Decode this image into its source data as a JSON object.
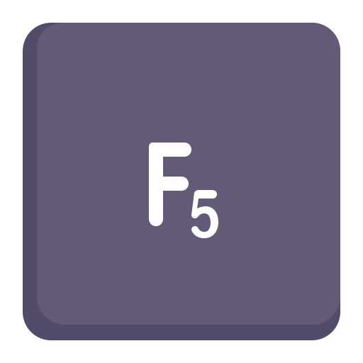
{
  "key": {
    "main_letter": "F",
    "subscript": "5",
    "colors": {
      "face": "#625a77",
      "shadow": "#524b69",
      "legend": "#ffffff",
      "background": "#ffffff"
    }
  }
}
